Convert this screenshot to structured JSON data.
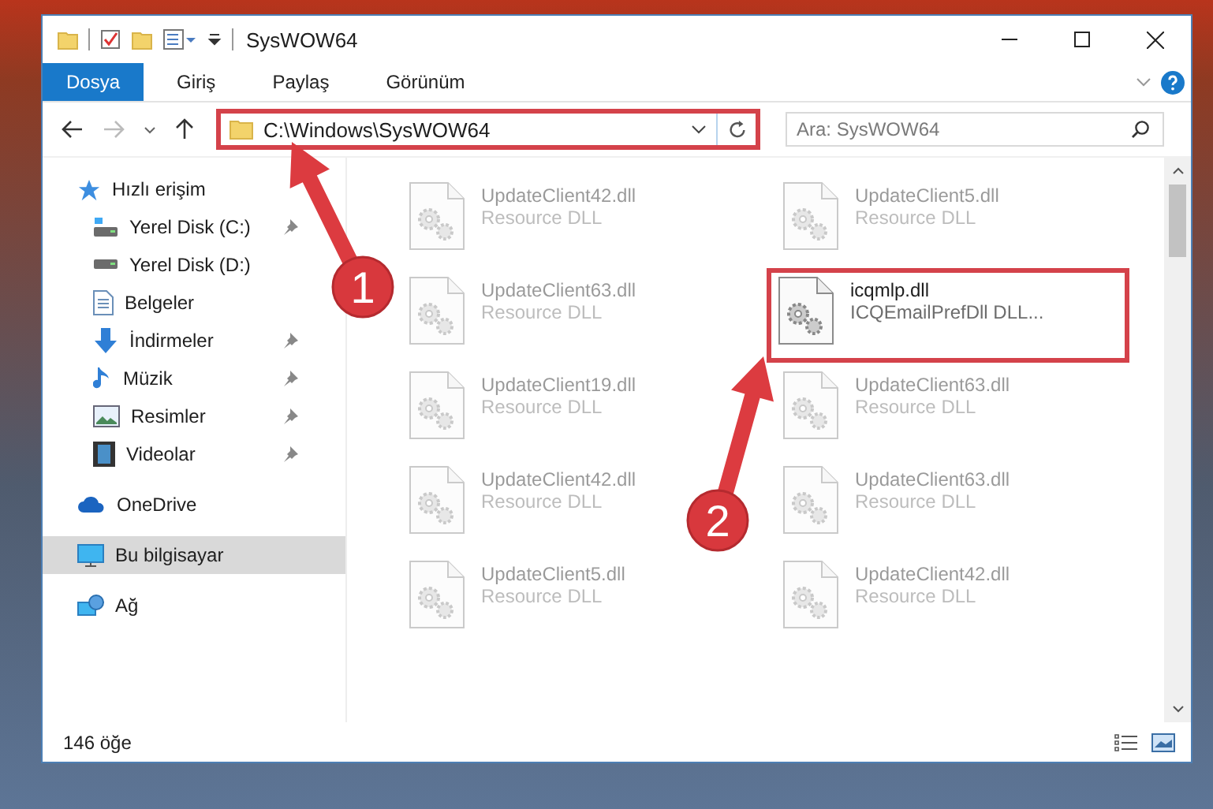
{
  "window": {
    "title": "SysWOW64"
  },
  "ribbon_tabs": [
    {
      "label": "Dosya",
      "selected": true
    },
    {
      "label": "Giriş",
      "selected": false
    },
    {
      "label": "Paylaş",
      "selected": false
    },
    {
      "label": "Görünüm",
      "selected": false
    }
  ],
  "address_bar": {
    "value": "C:\\Windows\\SysWOW64",
    "emphasized": true
  },
  "search": {
    "placeholder": "Ara: SysWOW64"
  },
  "sidebar": {
    "items": [
      {
        "label": "Hızlı erişim",
        "selected": false,
        "children": [
          {
            "label": "Yerel Disk (C:)",
            "pinned": true
          },
          {
            "label": "Yerel Disk (D:)",
            "pinned": false
          },
          {
            "label": "Belgeler",
            "pinned": false
          },
          {
            "label": "İndirmeler",
            "pinned": true
          },
          {
            "label": "Müzik",
            "pinned": true
          },
          {
            "label": "Resimler",
            "pinned": true
          },
          {
            "label": "Videolar",
            "pinned": true
          }
        ]
      },
      {
        "label": "OneDrive",
        "selected": false
      },
      {
        "label": "Bu bilgisayar",
        "selected": true
      },
      {
        "label": "Ağ",
        "selected": false
      }
    ]
  },
  "files": [
    {
      "name": "UpdateClient42.dll",
      "type": "Resource DLL",
      "faded": true,
      "emphasized": false
    },
    {
      "name": "UpdateClient5.dll",
      "type": "Resource DLL",
      "faded": true,
      "emphasized": false
    },
    {
      "name": "UpdateClient63.dll",
      "type": "Resource DLL",
      "faded": true,
      "emphasized": false
    },
    {
      "name": "icqmlp.dll",
      "type": "ICQEmailPrefDll DLL...",
      "faded": false,
      "emphasized": true
    },
    {
      "name": "UpdateClient19.dll",
      "type": "Resource DLL",
      "faded": true,
      "emphasized": false
    },
    {
      "name": "UpdateClient63.dll",
      "type": "Resource DLL",
      "faded": true,
      "emphasized": false
    },
    {
      "name": "UpdateClient42.dll",
      "type": "Resource DLL",
      "faded": true,
      "emphasized": false
    },
    {
      "name": "UpdateClient63.dll",
      "type": "Resource DLL",
      "faded": true,
      "emphasized": false
    },
    {
      "name": "UpdateClient5.dll",
      "type": "Resource DLL",
      "faded": true,
      "emphasized": false
    },
    {
      "name": "UpdateClient42.dll",
      "type": "Resource DLL",
      "faded": true,
      "emphasized": false
    }
  ],
  "status_bar": {
    "item_count": "146 öğe"
  },
  "callouts": [
    {
      "number": "1"
    },
    {
      "number": "2"
    }
  ]
}
